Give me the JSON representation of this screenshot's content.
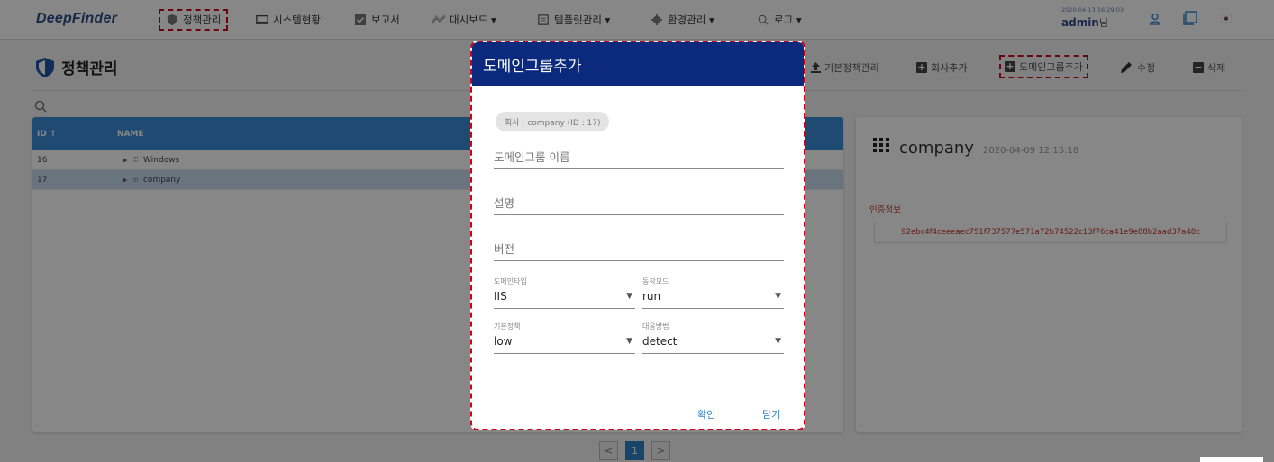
{
  "nav": {
    "logo": "DeepFinder",
    "items": [
      {
        "label": "정책관리",
        "icon": "shield-icon"
      },
      {
        "label": "시스템현황",
        "icon": "monitor-icon"
      },
      {
        "label": "보고서",
        "icon": "checkbox-icon"
      },
      {
        "label": "대시보드 ▾",
        "icon": "chart-line-icon"
      },
      {
        "label": "템플릿관리 ▾",
        "icon": "document-icon"
      },
      {
        "label": "환경관리 ▾",
        "icon": "gear-icon"
      },
      {
        "label": "로그 ▾",
        "icon": "search-icon"
      }
    ],
    "timestamp": "2020-04-13 16:29:03",
    "user": "admin",
    "user_suffix": "님"
  },
  "page": {
    "title": "정책관리",
    "toolbar": {
      "basic_policy": "기본정책관리",
      "add_company": "회사추가",
      "add_domain_group": "도메인그룹추가",
      "edit": "수정",
      "delete": "삭제"
    }
  },
  "table": {
    "columns": [
      "ID",
      "NAME"
    ],
    "rows": [
      {
        "id": "16",
        "name": "Windows"
      },
      {
        "id": "17",
        "name": "company"
      }
    ]
  },
  "detail": {
    "name": "company",
    "date": "2020-04-09 12:15:18",
    "auth_label": "인증정보",
    "auth_key": "92ebc4f4ceeeaec751f737577e571a72b74522c13f76ca41e9e88b2aad37a48c"
  },
  "pagination": {
    "prev": "<",
    "current": "1",
    "next": ">"
  },
  "modal": {
    "title": "도메인그룹추가",
    "company_chip": "회사 : company (ID : 17)",
    "fields": {
      "name_placeholder": "도메인그룹 이름",
      "desc_placeholder": "설명",
      "version_placeholder": "버전"
    },
    "selects": {
      "domain_type": {
        "label": "도메인타입",
        "value": "IIS"
      },
      "action_mode": {
        "label": "동작모드",
        "value": "run"
      },
      "default_policy": {
        "label": "기본정책",
        "value": "low"
      },
      "response": {
        "label": "대응방법",
        "value": "detect"
      }
    },
    "confirm": "확인",
    "close": "닫기"
  },
  "colors": {
    "header_blue": "#0b2a7e",
    "table_header": "#3b8fd9",
    "highlight": "#d0021b",
    "auth_red": "#c0392b"
  }
}
